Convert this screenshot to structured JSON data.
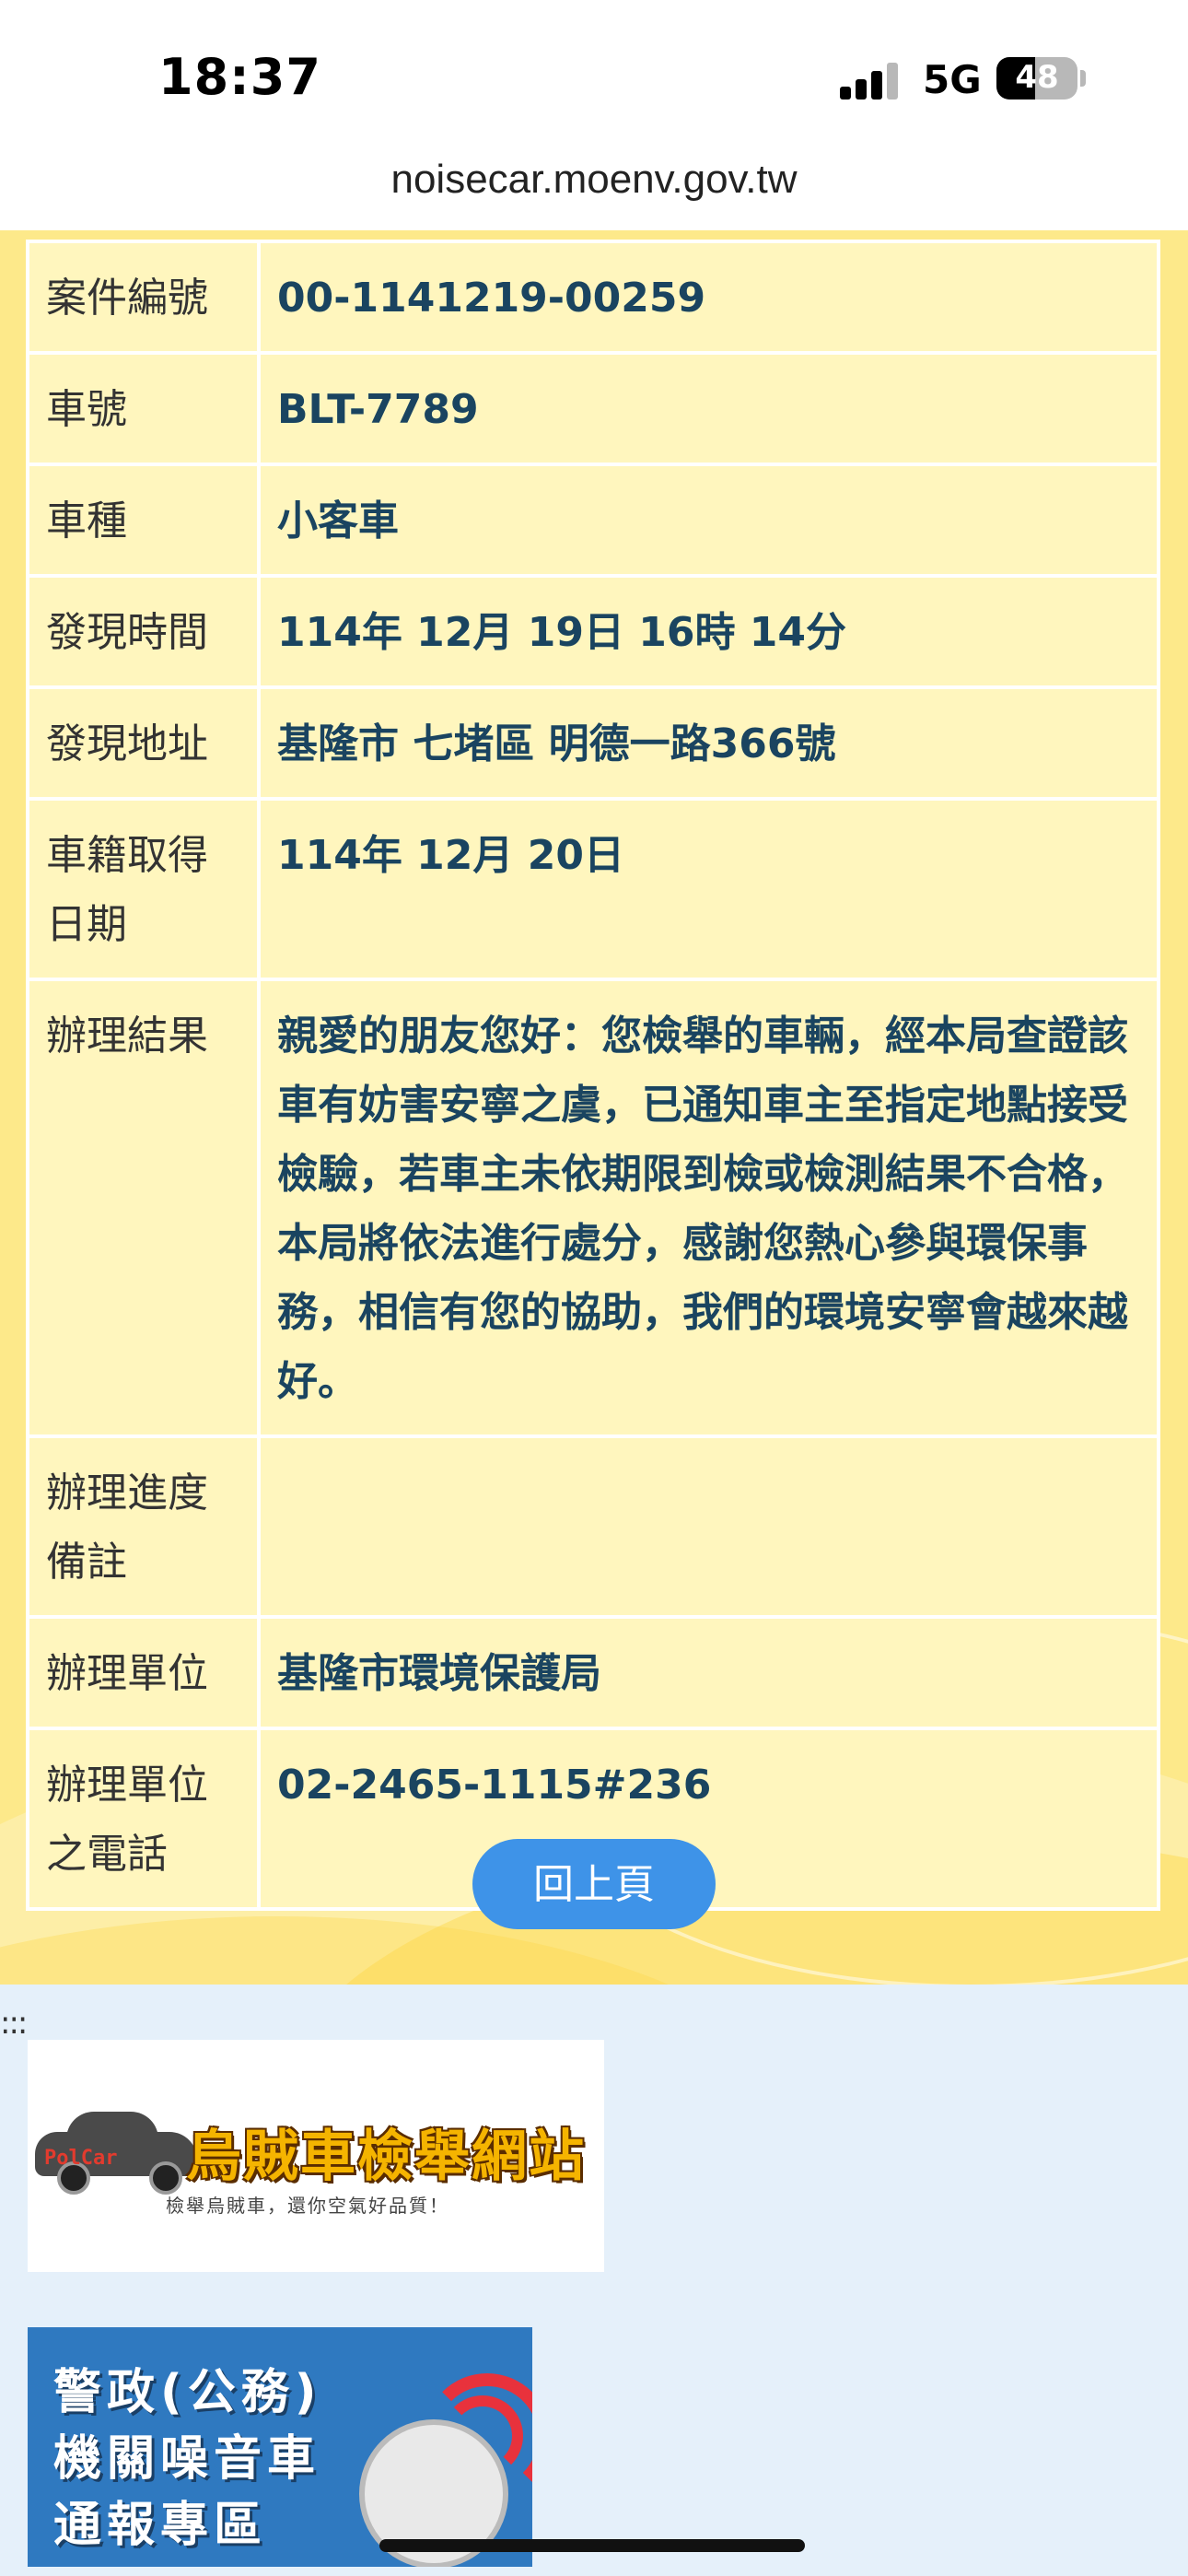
{
  "status_bar": {
    "time": "18:37",
    "network": "5G",
    "battery": "48",
    "battery_level": 0.48
  },
  "browser": {
    "url": "noisecar.moenv.gov.tw"
  },
  "detail_rows": [
    {
      "label": "案件編號",
      "value": "00-1141219-00259"
    },
    {
      "label": "車號",
      "value": "BLT-7789"
    },
    {
      "label": "車種",
      "value": "小客車"
    },
    {
      "label": "發現時間",
      "value": "114年 12月 19日 16時 14分"
    },
    {
      "label": "發現地址",
      "value": "基隆市 七堵區 明德一路366號"
    },
    {
      "label": "車籍取得日期",
      "value": "114年 12月 20日"
    },
    {
      "label": "辦理結果",
      "value": "親愛的朋友您好：您檢舉的車輛，經本局查證該車有妨害安寧之虞，已通知車主至指定地點接受檢驗，若車主未依期限到檢或檢測結果不合格，本局將依法進行處分，感謝您熱心參與環保事務，相信有您的協助，我們的環境安寧會越來越好。"
    },
    {
      "label": "辦理進度備註",
      "value": ""
    },
    {
      "label": "辦理單位",
      "value": "基隆市環境保護局"
    },
    {
      "label": "辦理單位之電話",
      "value": "02-2465-1115#236"
    }
  ],
  "back_button": "回上頁",
  "footer": {
    "colon_mark": ":::",
    "banner_polcar": {
      "logo_text": "PolCar",
      "title": "烏賊車檢舉網站",
      "subtitle": "檢舉烏賊車，還你空氣好品質！"
    },
    "banner_police": {
      "line1": "警政(公務)",
      "line2": "機關噪音車",
      "line3": "通報專區"
    }
  }
}
